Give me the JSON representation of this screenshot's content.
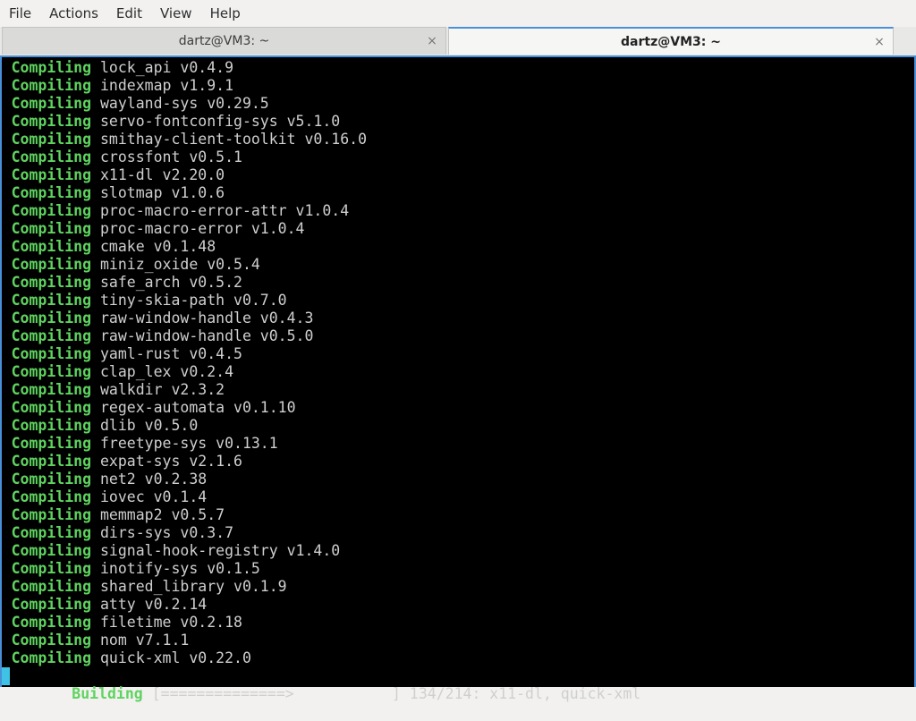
{
  "menu": [
    "File",
    "Actions",
    "Edit",
    "View",
    "Help"
  ],
  "tabs": [
    {
      "title": "dartz@VM3: ~",
      "active": false,
      "close": "×"
    },
    {
      "title": "dartz@VM3: ~",
      "active": true,
      "close": "×"
    }
  ],
  "terminal": {
    "keyword": "Compiling",
    "lines": [
      "lock_api v0.4.9",
      "indexmap v1.9.1",
      "wayland-sys v0.29.5",
      "servo-fontconfig-sys v5.1.0",
      "smithay-client-toolkit v0.16.0",
      "crossfont v0.5.1",
      "x11-dl v2.20.0",
      "slotmap v1.0.6",
      "proc-macro-error-attr v1.0.4",
      "proc-macro-error v1.0.4",
      "cmake v0.1.48",
      "miniz_oxide v0.5.4",
      "safe_arch v0.5.2",
      "tiny-skia-path v0.7.0",
      "raw-window-handle v0.4.3",
      "raw-window-handle v0.5.0",
      "yaml-rust v0.4.5",
      "clap_lex v0.2.4",
      "walkdir v2.3.2",
      "regex-automata v0.1.10",
      "dlib v0.5.0",
      "freetype-sys v0.13.1",
      "expat-sys v2.1.6",
      "net2 v0.2.38",
      "iovec v0.1.4",
      "memmap2 v0.5.7",
      "dirs-sys v0.3.7",
      "signal-hook-registry v1.4.0",
      "inotify-sys v0.1.5",
      "shared_library v0.1.9",
      "atty v0.2.14",
      "filetime v0.2.18",
      "nom v7.1.1",
      "quick-xml v0.22.0"
    ],
    "status": {
      "keyword": "Building",
      "bar": "[==============>           ]",
      "progress": "134/214: x11-dl, quick-xml"
    }
  },
  "colors": {
    "keyword": "#5fd35f",
    "text": "#cfcfcf",
    "background": "#000000",
    "accent": "#4a90d9",
    "cursor": "#3ec3e6"
  }
}
